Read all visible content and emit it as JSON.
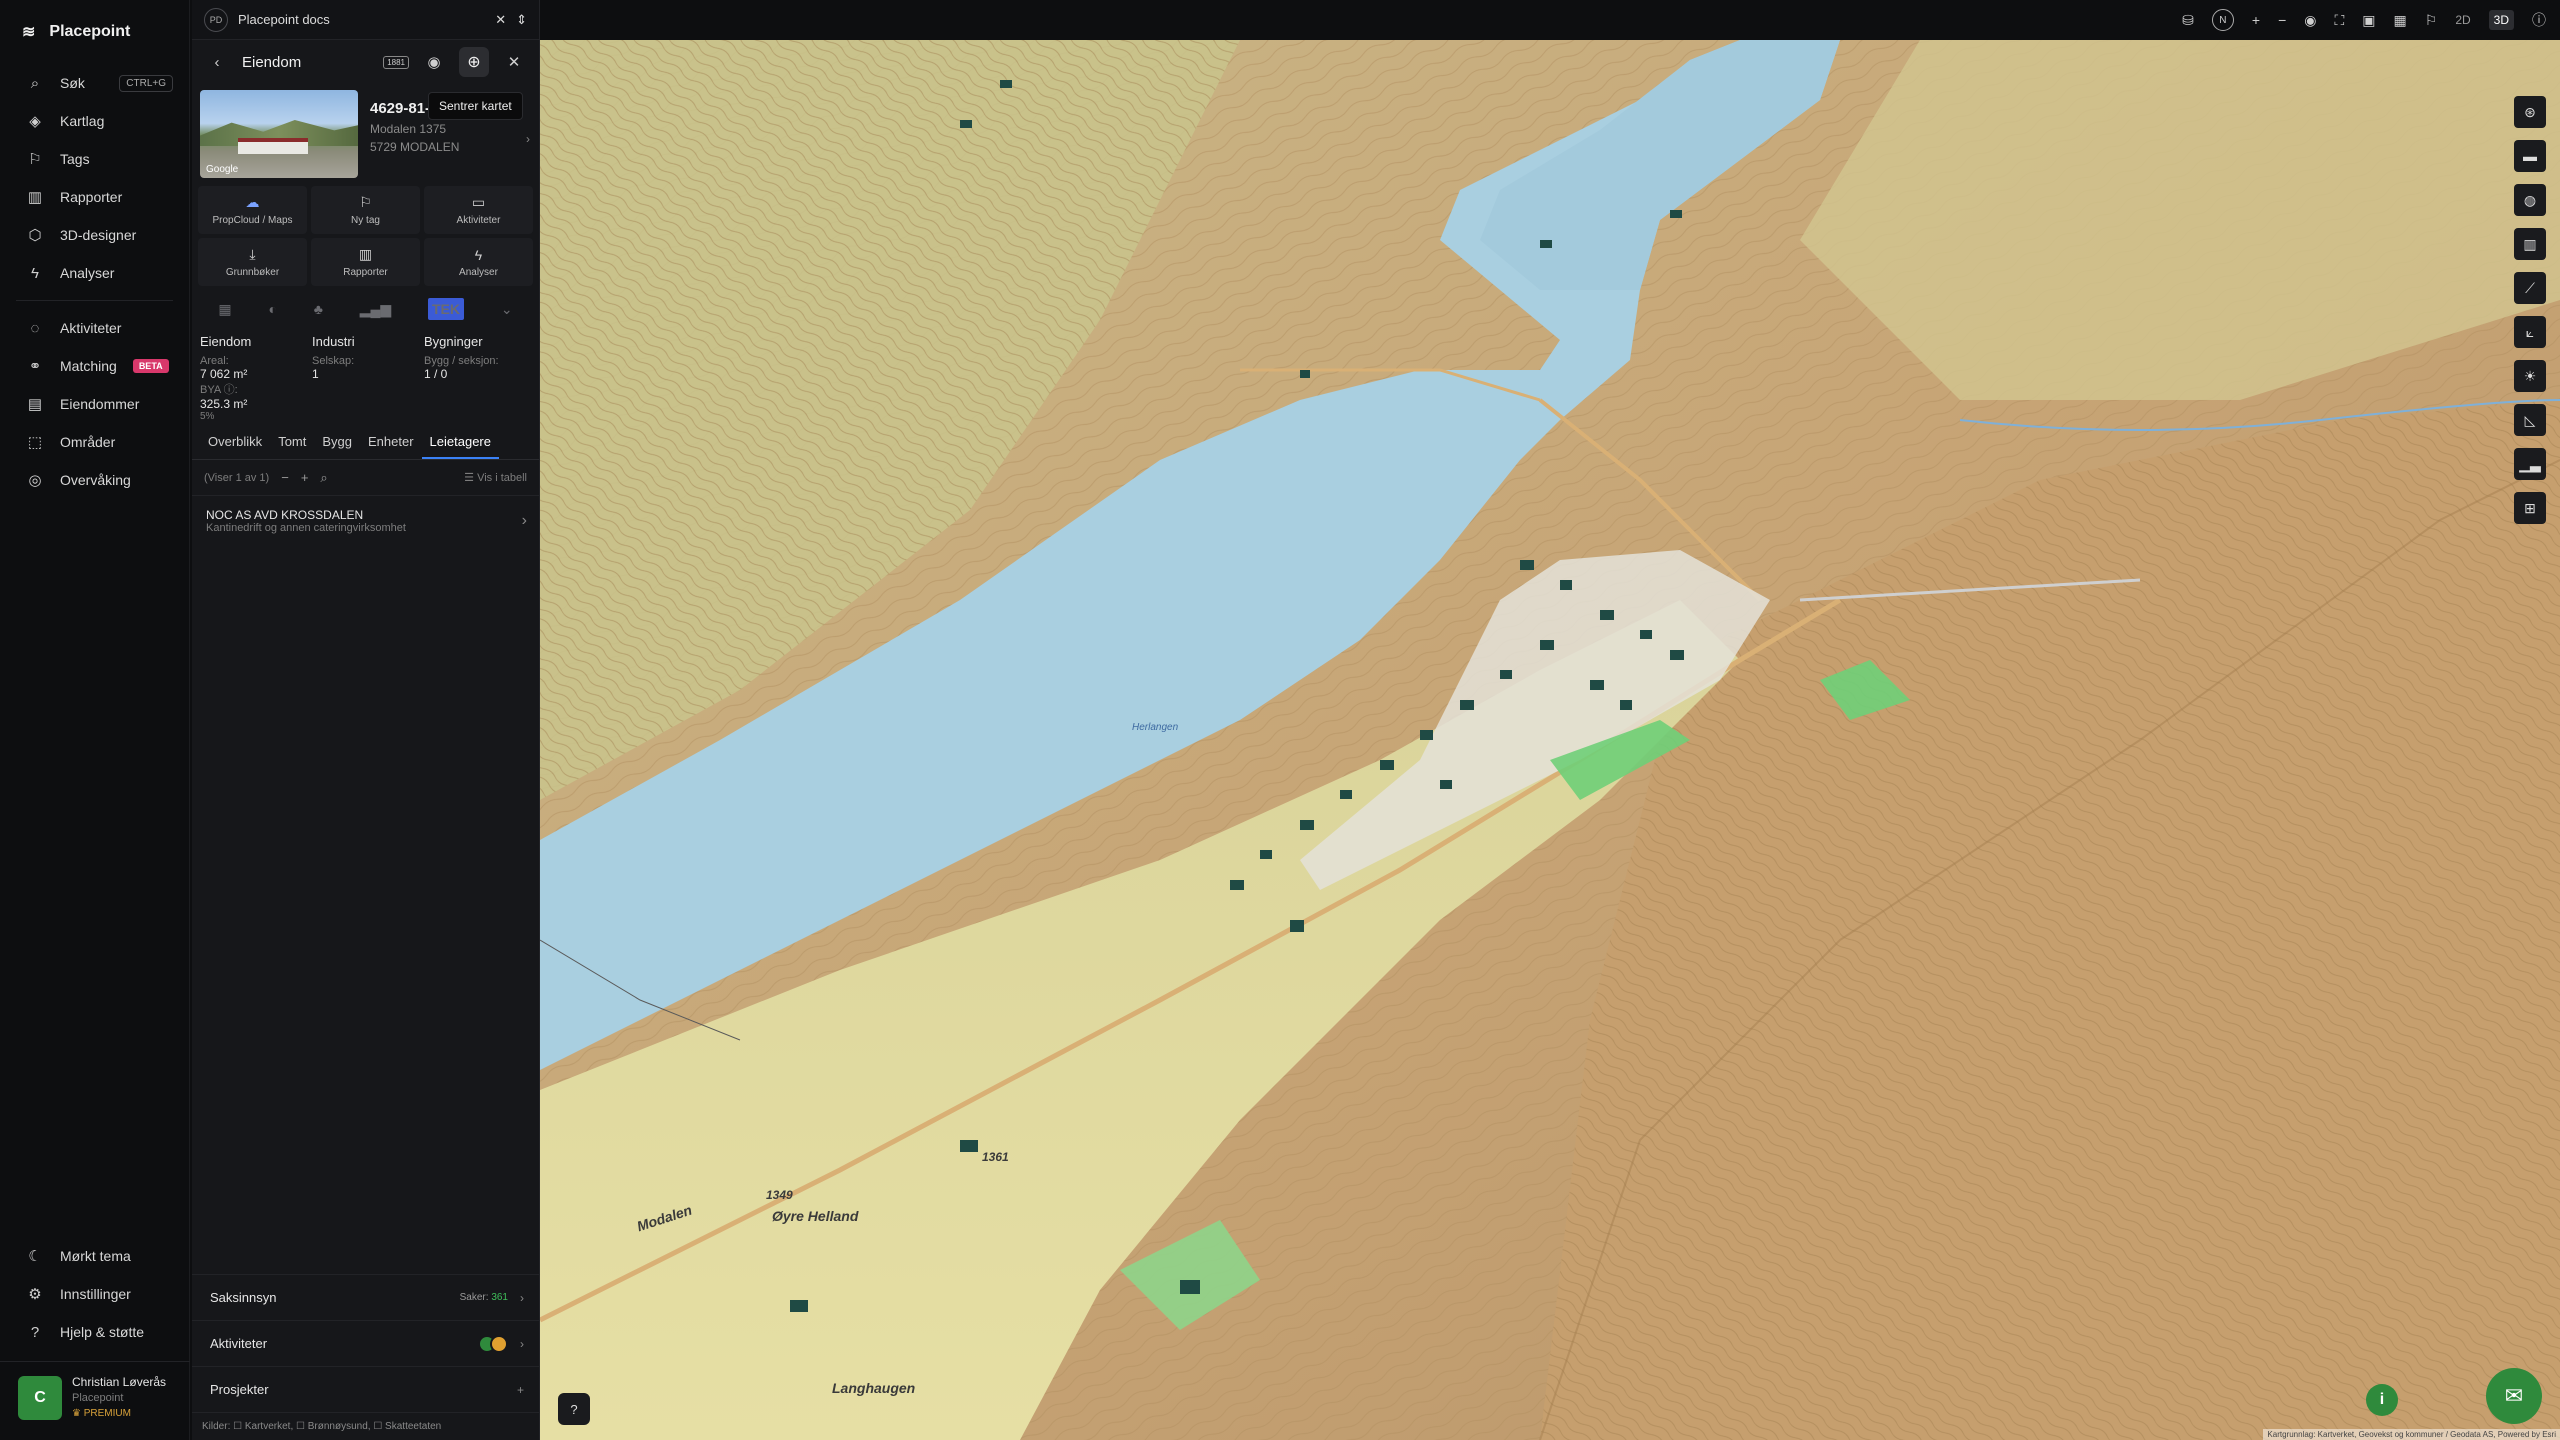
{
  "nav": {
    "brand": "Placepoint",
    "items": [
      {
        "label": "Søk",
        "icon": "search-icon",
        "kbd": "CTRL+G"
      },
      {
        "label": "Kartlag",
        "icon": "layers-icon"
      },
      {
        "label": "Tags",
        "icon": "bookmark-icon"
      },
      {
        "label": "Rapporter",
        "icon": "bar-chart-icon"
      },
      {
        "label": "3D-designer",
        "icon": "cube-icon"
      },
      {
        "label": "Analyser",
        "icon": "bolt-icon"
      }
    ],
    "items2": [
      {
        "label": "Aktiviteter",
        "icon": "chat-icon"
      },
      {
        "label": "Matching",
        "icon": "matching-icon",
        "badge": "BETA"
      },
      {
        "label": "Eiendommer",
        "icon": "building-icon"
      },
      {
        "label": "Områder",
        "icon": "area-icon"
      },
      {
        "label": "Overvåking",
        "icon": "watch-icon"
      }
    ],
    "bottom": [
      {
        "label": "Mørkt tema",
        "icon": "moon-icon"
      },
      {
        "label": "Innstillinger",
        "icon": "gear-icon"
      },
      {
        "label": "Hjelp & støtte",
        "icon": "help-icon"
      }
    ],
    "user": {
      "initial": "C",
      "name": "Christian Løverås",
      "org": "Placepoint",
      "plan": "PREMIUM"
    }
  },
  "panel": {
    "tab_badge": "PD",
    "tab_title": "Placepoint docs",
    "title": "Eiendom",
    "history_badge": "1881",
    "tooltip": "Sentrer kartet",
    "property": {
      "id": "4629-81-25-0-0",
      "address": "Modalen 1375",
      "postal": "5729 MODALEN",
      "thumb_credit": "Google"
    },
    "actions": [
      "PropCloud / Maps",
      "Ny tag",
      "Aktiviteter",
      "Grunnbøker",
      "Rapporter",
      "Analyser"
    ],
    "tek_badge": "TEK",
    "stats": {
      "col1": {
        "title": "Eiendom",
        "l1": "Areal:",
        "v1": "7 062 m²",
        "l2": "BYA ⓘ:",
        "v2": "325.3 m²",
        "pct": "5%"
      },
      "col2": {
        "title": "Industri",
        "l1": "Selskap:",
        "v1": "1"
      },
      "col3": {
        "title": "Bygninger",
        "l1": "Bygg / seksjon:",
        "v1": "1 / 0"
      }
    },
    "subtabs": [
      "Overblikk",
      "Tomt",
      "Bygg",
      "Enheter",
      "Leietagere"
    ],
    "active_subtab": "Leietagere",
    "toolbar": {
      "count": "(Viser 1 av 1)",
      "table": "Vis i tabell"
    },
    "tenant": {
      "name": "NOC AS AVD KROSSDALEN",
      "desc": "Kantinedrift og annen cateringvirksomhet"
    },
    "sections": {
      "saksinnsyn": "Saksinnsyn",
      "saker_label": "Saker:",
      "saker_count": "361",
      "aktiviteter": "Aktiviteter",
      "prosjekter": "Prosjekter"
    },
    "sources": "Kilder: ☐ Kartverket, ☐ Brønnøysund, ☐ Skatteetaten"
  },
  "topbar": {
    "north": "N",
    "mode2d": "2D",
    "mode3d": "3D"
  },
  "map": {
    "labels": [
      "Herlangen",
      "Øyre Helland",
      "Modalen",
      "1349",
      "1361",
      "Langhaugen"
    ],
    "attribution": "Kartgrunnlag: Kartverket, Geovekst og kommuner / Geodata AS, Powered by Esri"
  },
  "colors": {
    "accent": "#3b82f6",
    "green": "#2f8a3c",
    "water": "#a9cfe0",
    "beta": "#d8386b"
  }
}
